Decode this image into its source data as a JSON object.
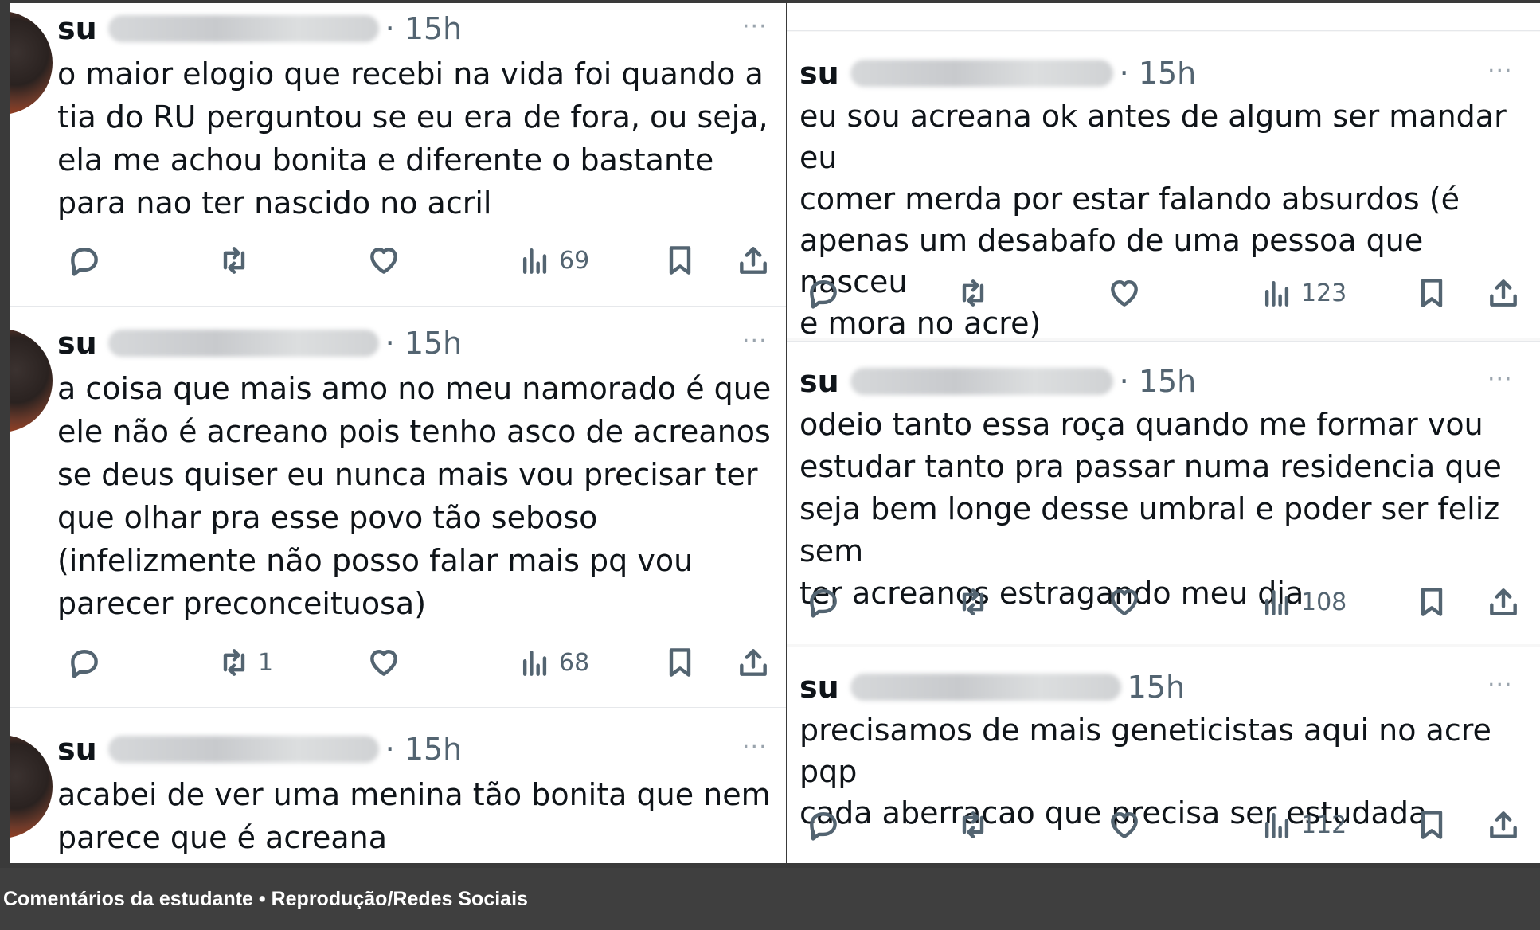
{
  "tweets_left": [
    {
      "name": "su",
      "time": "· 15h",
      "more": "···",
      "text": "o maior elogio que recebi na vida foi quando a\ntia do RU perguntou se eu era de fora, ou seja,\nela me achou bonita e diferente o bastante\npara nao ter nascido no acril",
      "retweets": "",
      "views": "69"
    },
    {
      "name": "su",
      "time": "· 15h",
      "more": "···",
      "text": "a coisa que mais amo no meu namorado é que\nele não é acreano pois tenho asco de acreanos\nse deus quiser eu nunca mais vou precisar ter\nque olhar pra esse povo tão seboso\n(infelizmente não posso falar mais pq vou\nparecer preconceituosa)",
      "retweets": "1",
      "views": "68"
    },
    {
      "name": "su",
      "time": "· 15h",
      "more": "···",
      "text": "acabei de ver uma menina tão bonita que nem\nparece que é acreana"
    }
  ],
  "tweets_right": [
    {
      "name": "su",
      "time": "· 15h",
      "more": "···",
      "text": "eu sou acreana ok antes de algum ser mandar eu\ncomer merda por estar falando absurdos (é\napenas um desabafo de uma pessoa que nasceu\ne mora no acre)",
      "views": "123"
    },
    {
      "name": "su",
      "time": "· 15h",
      "more": "···",
      "text": "odeio tanto essa roça quando me formar vou\nestudar tanto pra passar numa residencia que\nseja bem longe desse umbral e poder ser feliz sem\nter acreanos estragando meu dia",
      "views": "108"
    },
    {
      "name": "su",
      "time": "15h",
      "more": "···",
      "text": "precisamos de mais geneticistas aqui no acre pqp\ncada aberracao que precisa ser estudada",
      "views": "112"
    }
  ],
  "caption": "Comentários da estudante • Reprodução/Redes Sociais",
  "icons": [
    "reply-icon",
    "retweet-icon",
    "like-icon",
    "views-icon",
    "bookmark-icon",
    "share-icon"
  ]
}
